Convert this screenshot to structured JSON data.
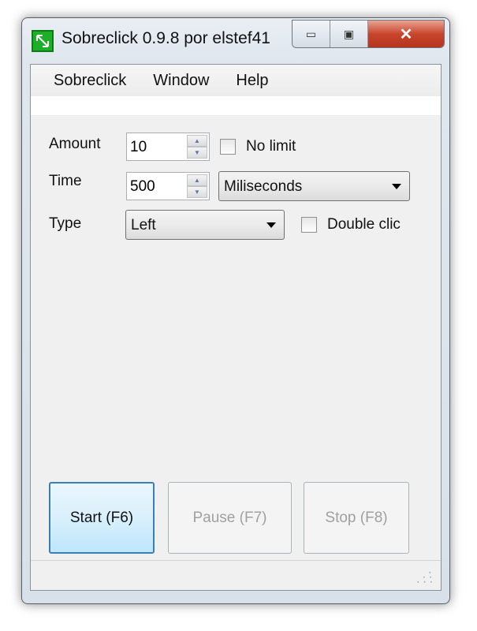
{
  "window": {
    "title": "Sobreclick 0.9.8 por elstef41"
  },
  "menu": [
    "Sobreclick",
    "Window",
    "Help"
  ],
  "form": {
    "amount_label": "Amount",
    "amount_value": "10",
    "no_limit_label": "No limit",
    "no_limit_checked": false,
    "time_label": "Time",
    "time_value": "500",
    "time_unit": "Miliseconds",
    "type_label": "Type",
    "type_value": "Left",
    "double_clic_label": "Double clic",
    "double_clic_checked": false
  },
  "buttons": {
    "start": "Start (F6)",
    "pause": "Pause (F7)",
    "stop": "Stop (F8)"
  }
}
